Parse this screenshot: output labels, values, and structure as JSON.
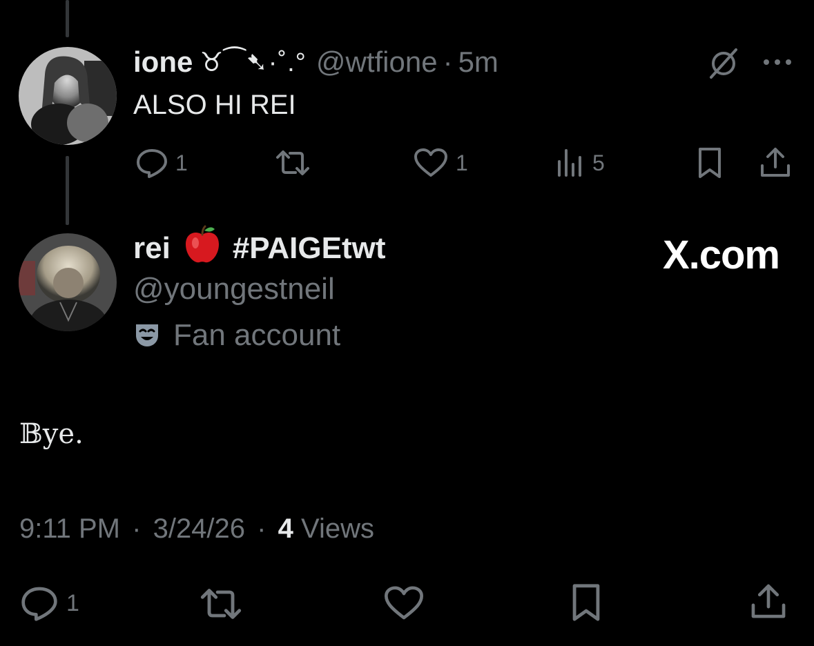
{
  "reply_tweet": {
    "display_name": "ione",
    "name_decoration": "♉⁀➷·˚.°",
    "handle": "@wtfione",
    "separator": "·",
    "time_ago": "5m",
    "text": "ALSO HI REI",
    "replies_count": "1",
    "likes_count": "1",
    "views_count": "5"
  },
  "main_tweet": {
    "display_name": "rei",
    "hashtag": "#PAIGEtwt",
    "handle": "@youngestneil",
    "account_label": "Fan account",
    "watermark": "X.com",
    "text": "𝔹ye.",
    "time": "9:11 PM",
    "separator": "·",
    "date": "3/24/26",
    "views_number": "4",
    "views_label": "Views",
    "replies_count": "1"
  },
  "colors": {
    "background": "#000000",
    "text_primary": "#e7e9ea",
    "text_secondary": "#71767b",
    "thread_line": "#333639"
  }
}
